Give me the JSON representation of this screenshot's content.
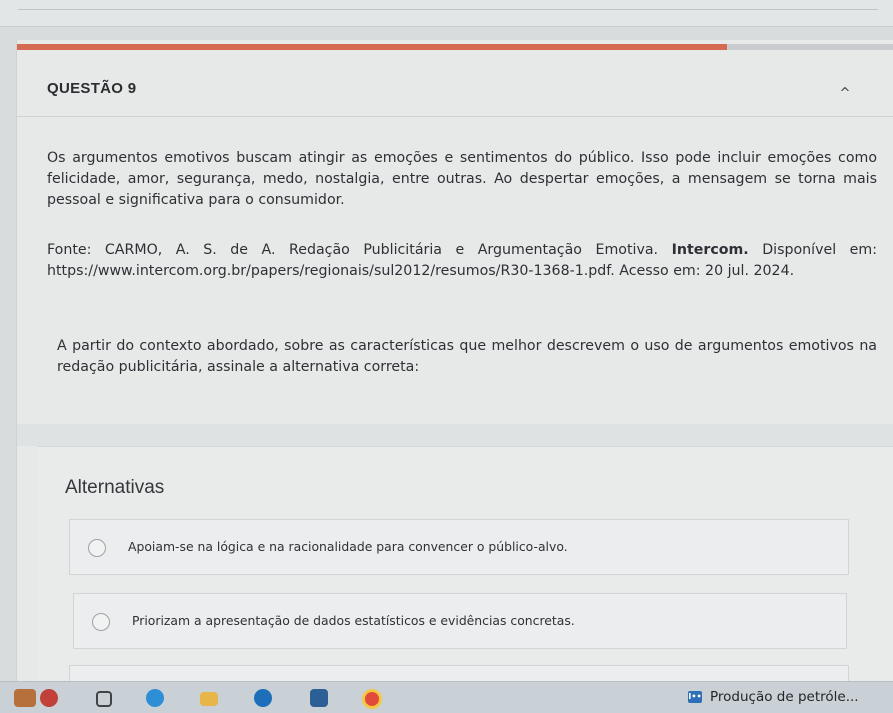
{
  "question": {
    "title": "QUESTÃO 9",
    "collapse_icon": "^",
    "progress_percent": 81,
    "accent": "#d46a52",
    "paragraph1": "Os argumentos emotivos buscam atingir as emoções e sentimentos do público. Isso pode incluir emoções como felicidade, amor, segurança, medo, nostalgia, entre outras. Ao despertar emoções, a mensagem se torna mais pessoal e significativa para o consumidor.",
    "source_prefix": "Fonte: CARMO, A. S. de A. Redação Publicitária e Argumentação Emotiva.",
    "source_bold": "Intercom.",
    "source_suffix": "Disponível em: https://www.intercom.org.br/papers/regionais/sul2012/resumos/R30-1368-1.pdf. Acesso em: 20 jul. 2024.",
    "prompt": "A partir do contexto abordado, sobre as características que melhor descrevem o uso de argumentos emotivos na redação publicitária, assinale a alternativa correta:"
  },
  "alternatives": {
    "title": "Alternativas",
    "options": [
      {
        "label": "Apoiam-se na lógica e na racionalidade para convencer o público-alvo.",
        "selected": false
      },
      {
        "label": "Priorizam a apresentação de dados estatísticos e evidências concretas.",
        "selected": false
      }
    ]
  },
  "taskbar": {
    "icons": [
      "game-icon",
      "snap-icon",
      "edge-icon",
      "folder-icon",
      "store-icon",
      "chrome-icon"
    ],
    "active_item_icon": "excel-icon",
    "active_item_badge": "I••",
    "active_item_label": "Produção de petróle..."
  }
}
